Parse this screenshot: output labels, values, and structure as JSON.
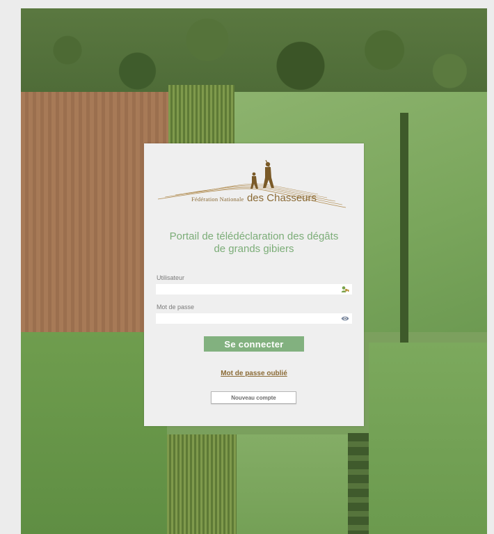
{
  "branding": {
    "org_prefix": "Fédération Nationale",
    "org_name": "des Chasseurs"
  },
  "portal": {
    "title_line1": "Portail de télédéclaration des dégâts",
    "title_line2": "de grands gibiers"
  },
  "form": {
    "user_label": "Utilisateur",
    "user_value": "",
    "password_label": "Mot de passe",
    "password_value": "",
    "user_icon": "user-key-icon",
    "password_icon": "eye-icon",
    "login_button": "Se connecter",
    "forgot_link": "Mot de passe oublié",
    "new_account_button": "Nouveau compte"
  },
  "colors": {
    "accent_green": "#82b17f",
    "brand_brown": "#8a6a35",
    "card_bg": "#efefef"
  }
}
